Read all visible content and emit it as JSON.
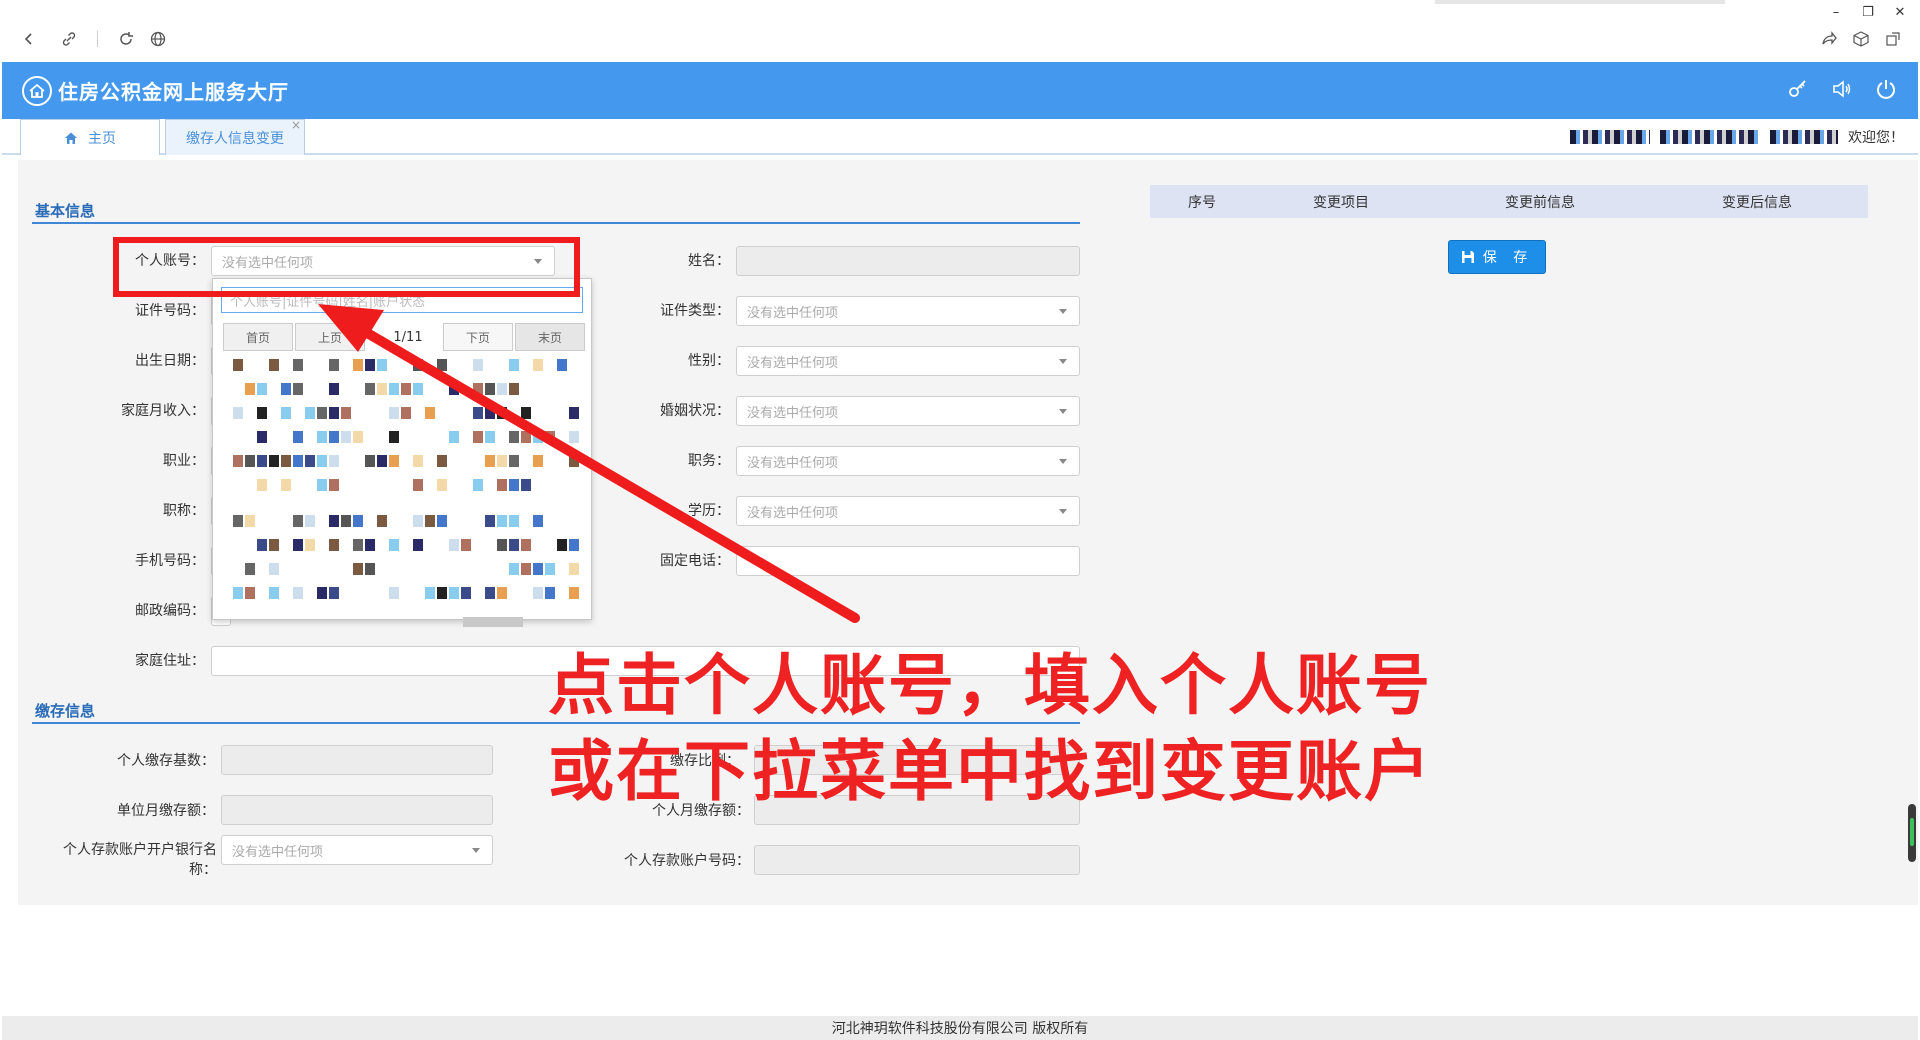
{
  "browser": {
    "back_icon": "chevron-left-icon",
    "link_icon": "link-icon",
    "reload_icon": "reload-icon",
    "globe_icon": "globe-icon",
    "minimize": "–",
    "restore": "❐",
    "close": "✕"
  },
  "header": {
    "title": "住房公积金网上服务大厅",
    "logo_icon": "house-icon",
    "key_icon": "key-icon",
    "sound_icon": "speaker-icon",
    "power_icon": "power-icon"
  },
  "tabs": [
    {
      "label": "主页",
      "icon": "home-icon"
    },
    {
      "label": "缴存人信息变更",
      "close": "×"
    }
  ],
  "user": {
    "welcome": "欢迎您！"
  },
  "basic_info": {
    "title": "基本信息",
    "fields": {
      "account": {
        "label": "个人账号：",
        "placeholder": "没有选中任何项"
      },
      "id_number": {
        "label": "证件号码："
      },
      "birth": {
        "label": "出生日期："
      },
      "income": {
        "label": "家庭月收入："
      },
      "occupation": {
        "label": "职业："
      },
      "title": {
        "label": "职称："
      },
      "mobile": {
        "label": "手机号码："
      },
      "postcode": {
        "label": "邮政编码："
      },
      "address": {
        "label": "家庭住址："
      },
      "name": {
        "label": "姓名："
      },
      "id_type": {
        "label": "证件类型：",
        "placeholder": "没有选中任何项"
      },
      "gender": {
        "label": "性别：",
        "placeholder": "没有选中任何项"
      },
      "marital": {
        "label": "婚姻状况：",
        "placeholder": "没有选中任何项"
      },
      "duty": {
        "label": "职务：",
        "placeholder": "没有选中任何项"
      },
      "education": {
        "label": "学历：",
        "placeholder": "没有选中任何项"
      },
      "phone": {
        "label": "固定电话："
      }
    }
  },
  "deposit_info": {
    "title": "缴存信息",
    "fields": {
      "base": {
        "label": "个人缴存基数："
      },
      "unit_monthly": {
        "label": "单位月缴存额："
      },
      "bank_name": {
        "label_line1": "个人存款账户开户银行名",
        "label_line2": "称：",
        "placeholder": "没有选中任何项"
      },
      "ratio": {
        "label": "缴存比例："
      },
      "personal_monthly": {
        "label": "个人月缴存额："
      },
      "bank_account": {
        "label": "个人存款账户号码："
      }
    }
  },
  "change_table": {
    "columns": [
      "序号",
      "变更项目",
      "变更前信息",
      "变更后信息"
    ]
  },
  "save_button": {
    "label": "保 存",
    "icon": "save-icon"
  },
  "dropdown": {
    "search_placeholder": "个人账号|证件号码|姓名|账户状态",
    "first": "首页",
    "prev": "上页",
    "page": "1/11",
    "next": "下页",
    "last": "末页"
  },
  "annotation": {
    "line1": "点击个人账号，填入个人账号",
    "line2": "或在下拉菜单中找到变更账户",
    "color": "#ee1c1c"
  },
  "footer": {
    "text": "河北神玥软件科技股份有限公司 版权所有"
  }
}
